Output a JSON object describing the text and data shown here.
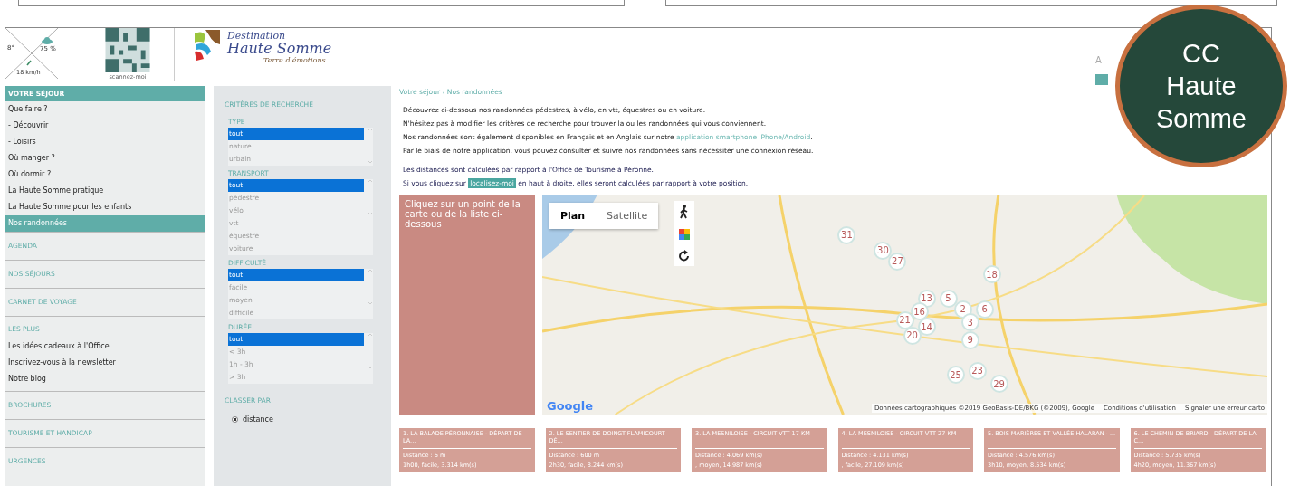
{
  "header": {
    "weather": {
      "temperature": "8°",
      "humidity": "75 %",
      "wind": "18 km/h"
    },
    "qr_caption": "scannez-moi",
    "logo": {
      "line_1": "Destination",
      "line_2": "Haute Somme",
      "tagline": "Terre d'émotions"
    },
    "font_control": "A"
  },
  "sidebar": {
    "sections": [
      {
        "title": "VOTRE SÉJOUR",
        "selected": true,
        "items": [
          {
            "label": "Que faire ?",
            "selected": false
          },
          {
            "label": " - Découvrir",
            "selected": false
          },
          {
            "label": " - Loisirs",
            "selected": false
          },
          {
            "label": "Où manger ?",
            "selected": false
          },
          {
            "label": "Où dormir ?",
            "selected": false
          },
          {
            "label": "La Haute Somme pratique",
            "selected": false
          },
          {
            "label": "La Haute Somme pour les enfants",
            "selected": false
          },
          {
            "label": "Nos randonnées",
            "selected": true
          }
        ]
      },
      {
        "title": "AGENDA",
        "selected": false
      },
      {
        "title": "NOS SÉJOURS",
        "selected": false
      },
      {
        "title": "CARNET DE VOYAGE",
        "selected": false
      },
      {
        "title": "LES PLUS",
        "selected": false,
        "items": [
          {
            "label": "Les idées cadeaux à l'Office",
            "selected": false
          },
          {
            "label": "Inscrivez-vous à la newsletter",
            "selected": false
          },
          {
            "label": "Notre blog",
            "selected": false
          }
        ]
      },
      {
        "title": "BROCHURES",
        "selected": false
      },
      {
        "title": "TOURISME ET HANDICAP",
        "selected": false
      },
      {
        "title": "URGENCES",
        "selected": false
      }
    ]
  },
  "filters": {
    "title": "CRITÈRES DE RECHERCHE",
    "groups": [
      {
        "label": "TYPE",
        "options": [
          {
            "label": "tout",
            "selected": true
          },
          {
            "label": "nature",
            "selected": false
          },
          {
            "label": "urbain",
            "selected": false
          }
        ]
      },
      {
        "label": "TRANSPORT",
        "options": [
          {
            "label": "tout",
            "selected": true
          },
          {
            "label": "pédestre",
            "selected": false
          },
          {
            "label": "vélo",
            "selected": false
          },
          {
            "label": "vtt",
            "selected": false
          },
          {
            "label": "équestre",
            "selected": false
          },
          {
            "label": "voiture",
            "selected": false
          }
        ]
      },
      {
        "label": "DIFFICULTÉ",
        "options": [
          {
            "label": "tout",
            "selected": true
          },
          {
            "label": "facile",
            "selected": false
          },
          {
            "label": "moyen",
            "selected": false
          },
          {
            "label": "difficile",
            "selected": false
          }
        ]
      },
      {
        "label": "DURÉE",
        "options": [
          {
            "label": "tout",
            "selected": true
          },
          {
            "label": "< 3h",
            "selected": false
          },
          {
            "label": "1h - 3h",
            "selected": false
          },
          {
            "label": "> 3h",
            "selected": false
          }
        ]
      }
    ],
    "sort": {
      "label": "CLASSER PAR",
      "options": [
        {
          "label": "distance",
          "selected": true
        }
      ]
    }
  },
  "content": {
    "breadcrumb": "Votre séjour › Nos randonnées",
    "intro": [
      {
        "text": "Découvrez ci-dessous nos randonnées pédestres, à vélo, en vtt, équestres ou en voiture."
      },
      {
        "text": "N'hésitez pas à modifier les critères de recherche pour trouver la ou les randonnées qui vous conviennent."
      },
      {
        "text": "Nos randonnées sont également disponibles en Français et en Anglais sur notre ",
        "link": "application smartphone iPhone/Android",
        "after": "."
      },
      {
        "text": "Par le biais de notre application, vous pouvez consulter et suivre nos randonnées sans nécessiter une connexion réseau."
      }
    ],
    "distance_note": [
      {
        "text": "Les distances sont calculées par rapport à l'Office de Tourisme à Péronne."
      },
      {
        "text": "Si vous cliquez sur ",
        "button": "localisez-moi",
        "after": " en haut à droite, elles seront calculées par rapport à votre position."
      }
    ],
    "map_hint": "Cliquez sur un point de la carte ou de la liste ci-dessous",
    "map": {
      "tabs": [
        {
          "label": "Plan",
          "selected": true
        },
        {
          "label": "Satellite",
          "selected": false
        }
      ],
      "logo": "Google",
      "attribution": "Données cartographiques ©2019 GeoBasis-DE/BKG (©2009), Google",
      "terms": "Conditions d'utilisation",
      "report": "Signaler une erreur carto",
      "markers": [
        "31",
        "30",
        "27",
        "18",
        "13",
        "5",
        "16",
        "2",
        "6",
        "21",
        "14",
        "3",
        "20",
        "9",
        "25",
        "23",
        "29"
      ]
    },
    "cards": [
      {
        "title": "1. LA BALADE PÉRONNAISE - DÉPART DE LA...",
        "distance": "Distance : 6 m",
        "details": "1h00, facile, 3.314 km(s)"
      },
      {
        "title": "2. LE SENTIER DE DOINGT-FLAMICOURT - DÉ...",
        "distance": "Distance : 600 m",
        "details": "2h30, facile, 8.244 km(s)"
      },
      {
        "title": "3. LA MESNILOISE - CIRCUIT VTT 17 KM",
        "distance": "Distance : 4.069 km(s)",
        "details": ", moyen, 14.987 km(s)"
      },
      {
        "title": "4. LA MESNILOISE - CIRCUIT VTT 27 KM",
        "distance": "Distance : 4.131 km(s)",
        "details": ", facile, 27.109 km(s)"
      },
      {
        "title": "5. BOIS MARIÈRES ET VALLÉE HALARAN - ...",
        "distance": "Distance : 4.576 km(s)",
        "details": "3h10, moyen, 8.534 km(s)"
      },
      {
        "title": "6. LE CHEMIN DE BRIARD - DÉPART DE LA C...",
        "distance": "Distance : 5.735 km(s)",
        "details": "4h20, moyen, 11.367 km(s)"
      }
    ]
  },
  "badge": {
    "text": "CC Haute Somme"
  }
}
